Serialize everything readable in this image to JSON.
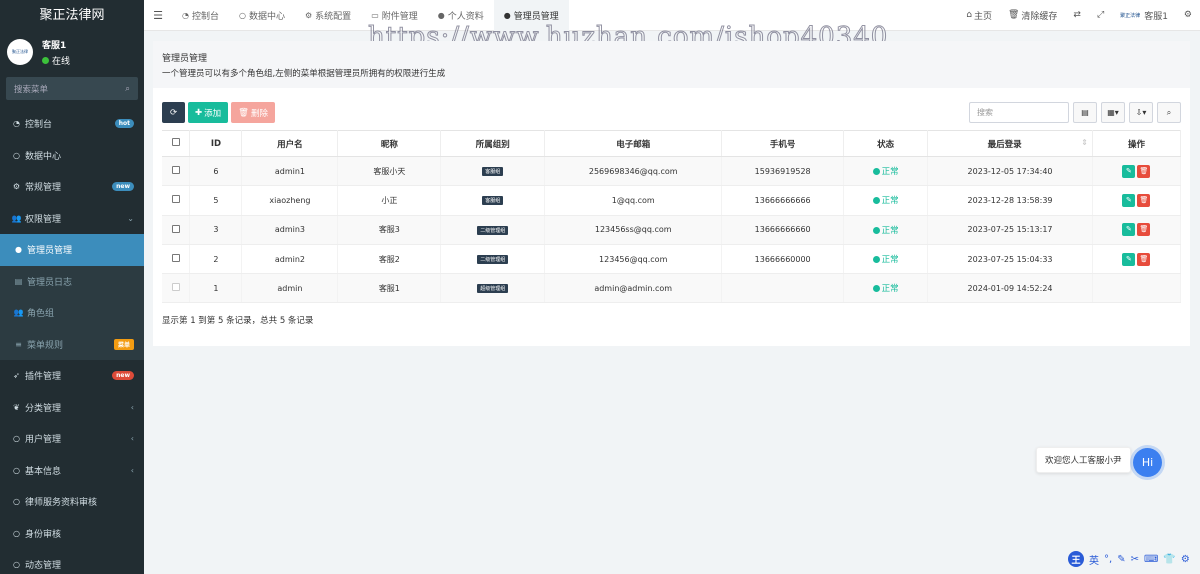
{
  "app": {
    "brand": "聚正法律网",
    "user": {
      "name": "客服1",
      "status": "在线",
      "logo_text": "聚正法律"
    },
    "search_placeholder": "搜索菜单"
  },
  "sidebar": {
    "items": [
      {
        "label": "控制台",
        "icon": "dashboard-icon",
        "badge": "hot",
        "badge_color": "blue"
      },
      {
        "label": "数据中心",
        "icon": "circle-icon"
      },
      {
        "label": "常规管理",
        "icon": "cogs-icon",
        "badge": "new",
        "badge_color": "blue"
      },
      {
        "label": "权限管理",
        "icon": "group-icon",
        "caret": "⌄"
      },
      {
        "label": "管理员管理",
        "icon": "user-icon",
        "sub": true,
        "active": true
      },
      {
        "label": "管理员日志",
        "icon": "list-icon",
        "sub": true
      },
      {
        "label": "角色组",
        "icon": "group-icon",
        "sub": true
      },
      {
        "label": "菜单规则",
        "icon": "bars-icon",
        "sub": true,
        "badge": "菜单",
        "badge_color": "orange"
      },
      {
        "label": "插件管理",
        "icon": "rocket-icon",
        "badge": "new",
        "badge_color": "red"
      },
      {
        "label": "分类管理",
        "icon": "leaf-icon",
        "caret": "‹"
      },
      {
        "label": "用户管理",
        "icon": "circle-icon",
        "caret": "‹"
      },
      {
        "label": "基本信息",
        "icon": "circle-icon",
        "caret": "‹"
      },
      {
        "label": "律师服务资料审核",
        "icon": "circle-icon"
      },
      {
        "label": "身份审核",
        "icon": "circle-icon"
      },
      {
        "label": "动态管理",
        "icon": "circle-icon"
      }
    ]
  },
  "topbar": {
    "tabs": [
      {
        "label": "控制台",
        "icon": "dashboard-icon"
      },
      {
        "label": "数据中心",
        "icon": "circle-icon"
      },
      {
        "label": "系统配置",
        "icon": "gear-icon"
      },
      {
        "label": "附件管理",
        "icon": "file-icon"
      },
      {
        "label": "个人资料",
        "icon": "user-icon"
      },
      {
        "label": "管理员管理",
        "icon": "user-icon",
        "active": true
      }
    ],
    "right": {
      "home": "主页",
      "clear_cache": "清除缓存",
      "user": "客服1",
      "logo_text": "聚正法律"
    }
  },
  "watermark": "https://www.huzhan.com/ishop40340",
  "page": {
    "title": "管理员管理",
    "description": "一个管理员可以有多个角色组,左侧的菜单根据管理员所拥有的权限进行生成",
    "toolbar": {
      "add": "添加",
      "delete": "删除"
    },
    "search_placeholder": "搜索",
    "columns": [
      "ID",
      "用户名",
      "昵称",
      "所属组别",
      "电子邮箱",
      "手机号",
      "状态",
      "最后登录",
      "操作"
    ],
    "rows": [
      {
        "id": "6",
        "username": "admin1",
        "nickname": "客服小天",
        "group": "客服组",
        "email": "2569698346@qq.com",
        "mobile": "15936919528",
        "status": "正常",
        "last_login": "2023-12-05 17:34:40",
        "actions": true,
        "disabled": false
      },
      {
        "id": "5",
        "username": "xiaozheng",
        "nickname": "小正",
        "group": "客服组",
        "email": "1@qq.com",
        "mobile": "13666666666",
        "status": "正常",
        "last_login": "2023-12-28 13:58:39",
        "actions": true,
        "disabled": false
      },
      {
        "id": "3",
        "username": "admin3",
        "nickname": "客服3",
        "group": "二级管理组",
        "email": "123456ss@qq.com",
        "mobile": "13666666660",
        "status": "正常",
        "last_login": "2023-07-25 15:13:17",
        "actions": true,
        "disabled": false
      },
      {
        "id": "2",
        "username": "admin2",
        "nickname": "客服2",
        "group": "二级管理组",
        "email": "123456@qq.com",
        "mobile": "13666660000",
        "status": "正常",
        "last_login": "2023-07-25 15:04:33",
        "actions": true,
        "disabled": false
      },
      {
        "id": "1",
        "username": "admin",
        "nickname": "客服1",
        "group": "超级管理组",
        "email": "admin@admin.com",
        "mobile": "",
        "status": "正常",
        "last_login": "2024-01-09 14:52:24",
        "actions": false,
        "disabled": true
      }
    ],
    "pagination_info": "显示第 1 到第 5 条记录，总共 5 条记录"
  },
  "chat": {
    "bubble": "欢迎您人工客服小尹",
    "button": "Hi"
  },
  "ime": {
    "logo": "王",
    "mode": "英"
  },
  "colors": {
    "sidebar_bg": "#222d32",
    "active": "#3c8dbc",
    "success": "#18bc9c",
    "danger": "#e74c3c",
    "primary_dark": "#2c3e50"
  }
}
